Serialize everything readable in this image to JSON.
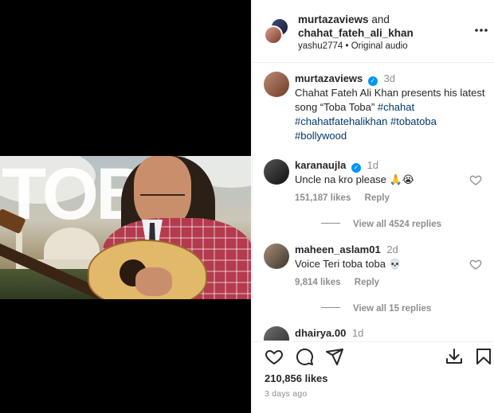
{
  "media": {
    "overlay_title": "TOBA"
  },
  "header": {
    "author": "murtazaviews",
    "conjunction": "and",
    "collaborator": "chahat_fateh_ali_khan",
    "audio_user": "yashu2774",
    "audio_separator": "•",
    "audio_label": "Original audio",
    "more_icon": "more-horizontal-icon"
  },
  "caption": {
    "username": "murtazaviews",
    "time": "3d",
    "text": "Chahat Fateh Ali Khan presents his latest song “Toba Toba”",
    "hashtags": [
      "#chahat",
      "#chahatfatehalikhan",
      "#tobatoba",
      "#bollywood"
    ]
  },
  "comments": [
    {
      "username": "karanaujla",
      "verified": true,
      "time": "1d",
      "text": "Uncle na kro please 🙏😭",
      "likes": "151,187 likes",
      "reply": "Reply",
      "view_replies": "View all 4524 replies"
    },
    {
      "username": "maheen_aslam01",
      "verified": false,
      "time": "2d",
      "text": "Voice Teri toba toba 💀",
      "likes": "9,814 likes",
      "reply": "Reply",
      "view_replies": "View all 15 replies"
    },
    {
      "username": "dhairya.00",
      "verified": false,
      "time": "1d"
    }
  ],
  "actions": {
    "icons": [
      "heart-icon",
      "comment-icon",
      "share-icon",
      "download-icon",
      "bookmark-icon"
    ]
  },
  "post": {
    "likes": "210,856 likes",
    "date": "3 days ago"
  },
  "colors": {
    "link": "#00376b",
    "verified": "#0095f6",
    "muted": "#8e8e8e",
    "text": "#262626"
  }
}
